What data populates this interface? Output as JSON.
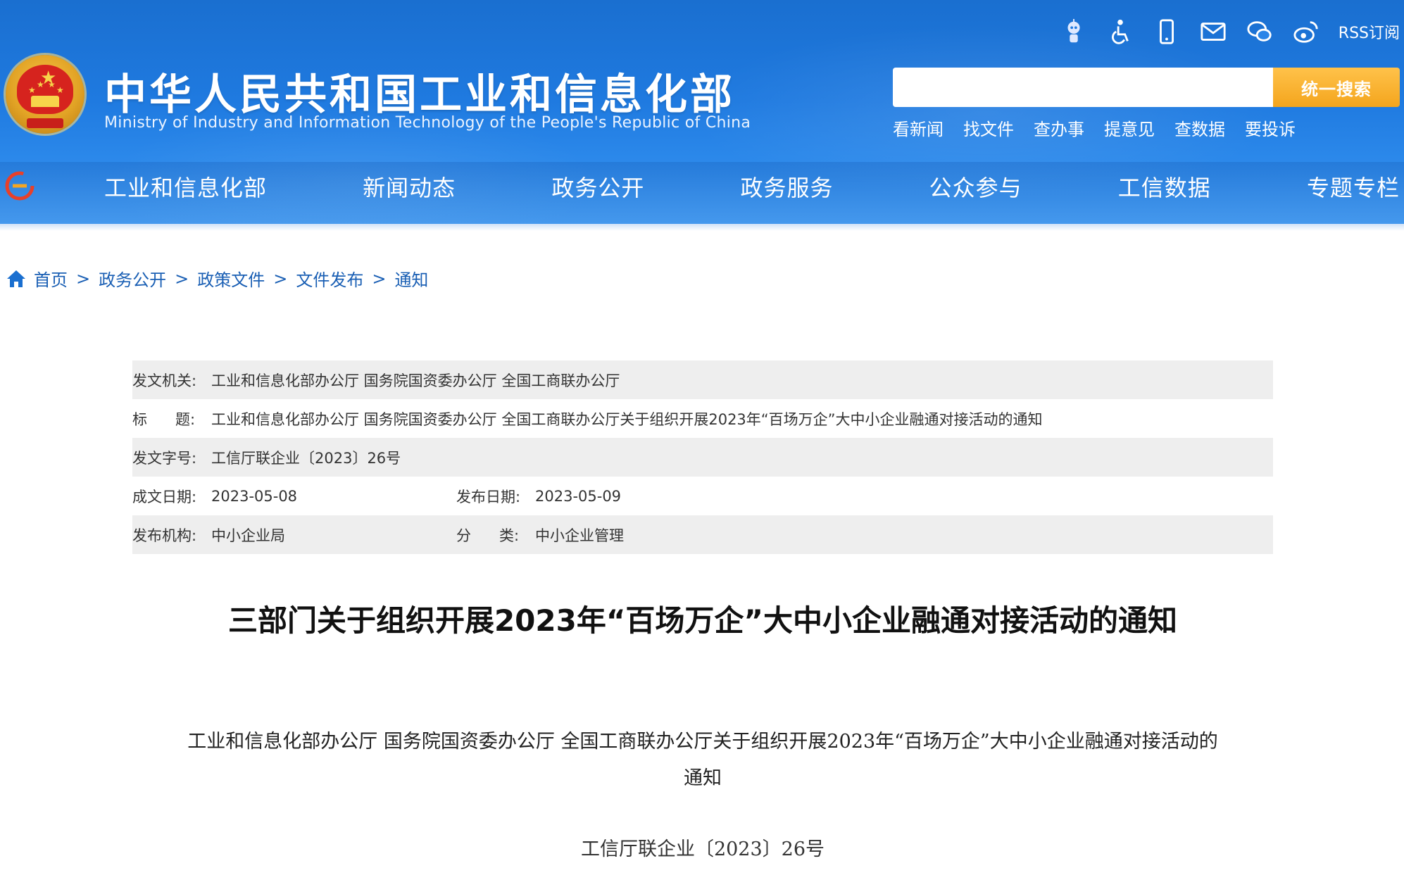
{
  "header": {
    "site_title": "中华人民共和国工业和信息化部",
    "site_subtitle": "Ministry of Industry and Information Technology of the People's Republic of China",
    "rss_label": "RSS订阅",
    "util_icons": [
      "robot-icon",
      "accessibility-icon",
      "mobile-icon",
      "mail-icon",
      "wechat-icon",
      "weibo-icon"
    ],
    "search": {
      "placeholder": "",
      "button_label": "统一搜索"
    },
    "quick_links": [
      "看新闻",
      "找文件",
      "查办事",
      "提意见",
      "查数据",
      "要投诉"
    ],
    "nav": [
      "工业和信息化部",
      "新闻动态",
      "政务公开",
      "政务服务",
      "公众参与",
      "工信数据",
      "专题专栏"
    ]
  },
  "breadcrumb": [
    "首页",
    "政务公开",
    "政策文件",
    "文件发布",
    "通知"
  ],
  "breadcrumb_sep": ">",
  "meta": {
    "issuer_label": "发文机关:",
    "issuer": "工业和信息化部办公厅 国务院国资委办公厅 全国工商联办公厅",
    "title_label": "标      题:",
    "title": "工业和信息化部办公厅 国务院国资委办公厅 全国工商联办公厅关于组织开展2023年“百场万企”大中小企业融通对接活动的通知",
    "docno_label": "发文字号:",
    "docno": "工信厅联企业〔2023〕26号",
    "created_label": "成文日期:",
    "created": "2023-05-08",
    "published_label": "发布日期:",
    "published": "2023-05-09",
    "agency_label": "发布机构:",
    "agency": "中小企业局",
    "category_label": "分      类:",
    "category": "中小企业管理"
  },
  "article": {
    "title": "三部门关于组织开展2023年“百场万企”大中小企业融通对接活动的通知",
    "heading_line1": "工业和信息化部办公厅  国务院国资委办公厅  全国工商联办公厅关于组织开展2023年“百场万企”大中小企业融通对接活动的",
    "heading_line2": "通知",
    "docno": "工信厅联企业〔2023〕26号"
  },
  "colors": {
    "header_blue": "#1f7ae0",
    "search_orange": "#f4a51d",
    "link_blue": "#1a5fb4",
    "meta_shade": "#eeeeee"
  }
}
